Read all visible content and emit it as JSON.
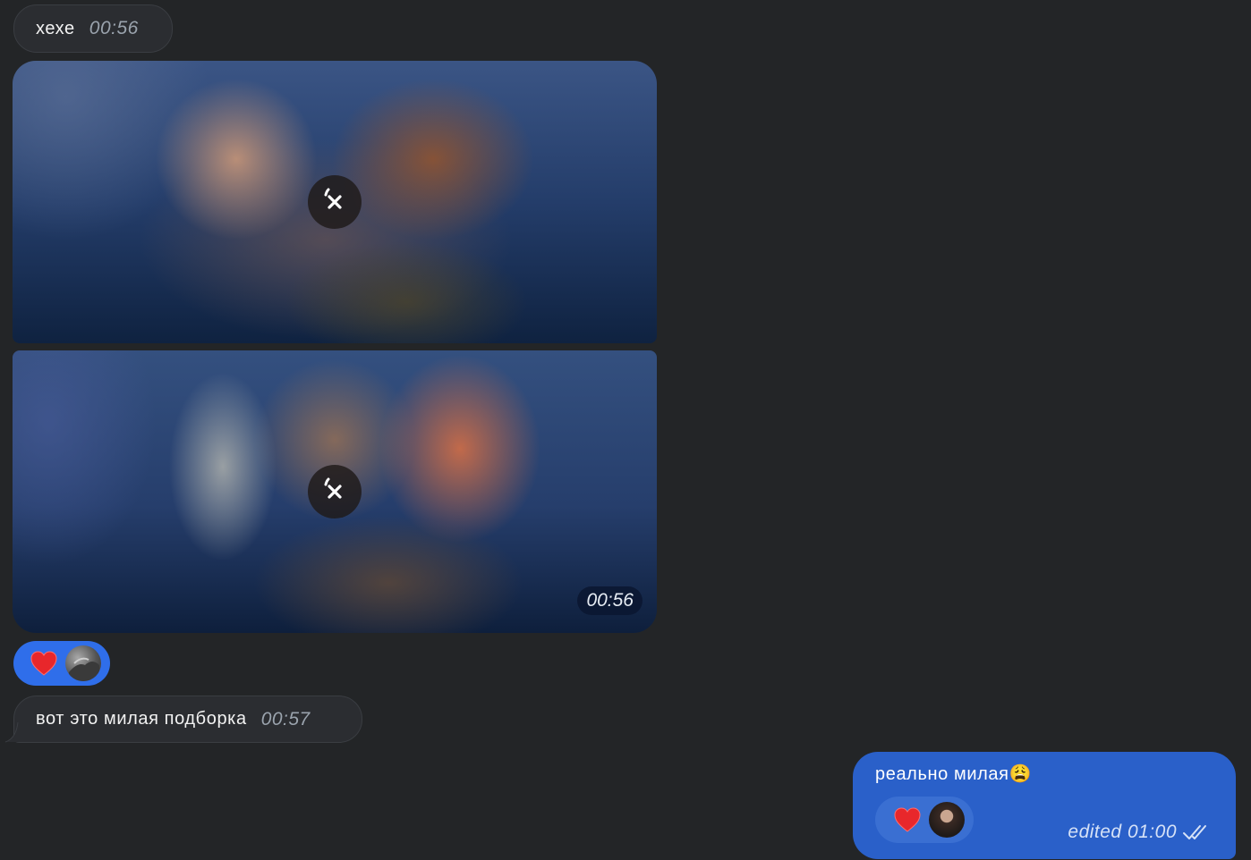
{
  "messages": {
    "first": {
      "text": "хехе",
      "time": "00:56"
    },
    "album": {
      "time": "00:56"
    },
    "reaction_in": {
      "emoji_icon": "heart-icon",
      "color": "#ff3b30"
    },
    "second": {
      "text": "вот это милая подборка",
      "time": "00:57"
    },
    "outgoing": {
      "text": "реально милая😩",
      "status": "edited 01:00",
      "bubble_color": "#2a60c9",
      "reaction_icon": "heart-icon"
    }
  },
  "colors": {
    "background": "#232527",
    "incoming_bubble": "#2b2d31",
    "accent_blue": "#2f6eea",
    "time_gray": "#9aa3ad"
  }
}
